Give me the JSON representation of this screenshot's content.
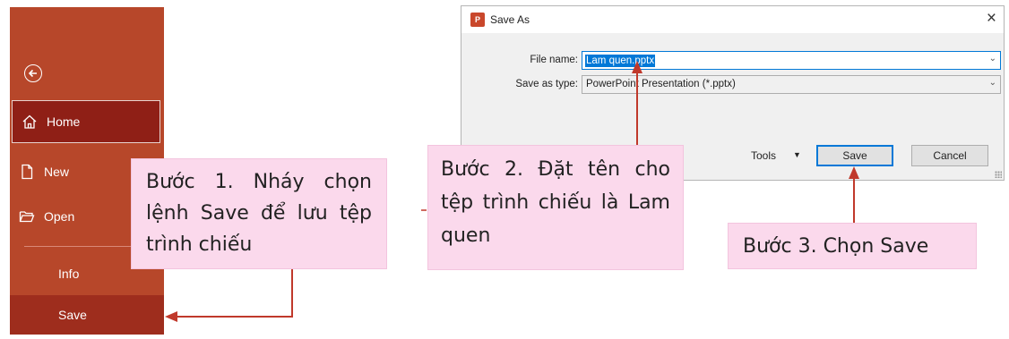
{
  "sidebar": {
    "back_icon": "back-arrow-circle-icon",
    "items": [
      {
        "label": "Home",
        "icon": "home-icon"
      },
      {
        "label": "New",
        "icon": "new-document-icon"
      },
      {
        "label": "Open",
        "icon": "folder-open-icon"
      },
      {
        "label": "Info"
      },
      {
        "label": "Save"
      }
    ],
    "colors": {
      "background": "#b7472a",
      "home_active": "#8f1f16",
      "save_active": "#9e2d1d"
    }
  },
  "dialog": {
    "title": "Save As",
    "app_icon": "powerpoint-icon",
    "app_icon_text": "P",
    "close_symbol": "×",
    "file_name_label": "File name:",
    "file_name_value": "Lam quen.pptx",
    "save_as_type_label": "Save as type:",
    "save_as_type_value": "PowerPoint Presentation (*.pptx)",
    "tools_label": "Tools",
    "save_button": "Save",
    "cancel_button": "Cancel"
  },
  "callouts": {
    "step1": "Bước 1. Nháy chọn lệnh Save để lưu tệp trình chiếu",
    "step2": "Bước 2. Đặt tên cho tệp trình chiếu là Lam quen",
    "step3": "Bước 3. Chọn Save"
  },
  "colors": {
    "callout_bg": "#fbd9ec",
    "arrow": "#c0392b",
    "accent": "#0078d7"
  }
}
